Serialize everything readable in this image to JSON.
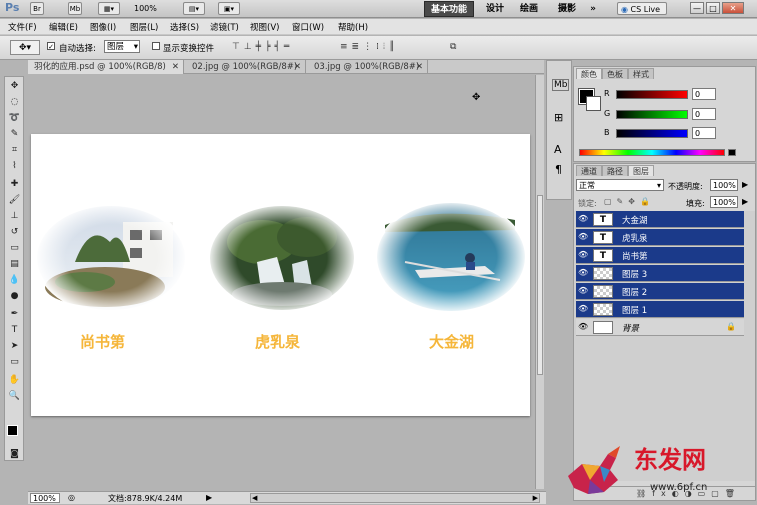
{
  "app": {
    "logo": "Ps"
  },
  "appbar": {
    "btn_br": "Br",
    "btn_mb": "Mb",
    "zoom": "100%",
    "workspaces": [
      "基本功能",
      "设计",
      "绘画",
      "摄影"
    ],
    "more": "»",
    "cslive": "CS Live",
    "win": [
      "—",
      "□",
      "✕"
    ]
  },
  "menubar": {
    "items": [
      "文件(F)",
      "编辑(E)",
      "图像(I)",
      "图层(L)",
      "选择(S)",
      "滤镜(T)",
      "视图(V)",
      "窗口(W)",
      "帮助(H)"
    ]
  },
  "options": {
    "auto_select_label": "自动选择:",
    "auto_select_value": "图层",
    "show_transform_label": "显示变换控件"
  },
  "doc_tabs": [
    {
      "title": "羽化的应用.psd @ 100%(RGB/8)",
      "close": "✕"
    },
    {
      "title": "02.jpg @ 100%(RGB/8#)",
      "close": "✕"
    },
    {
      "title": "03.jpg @ 100%(RGB/8#)",
      "close": "✕"
    }
  ],
  "canvas": {
    "captions": [
      "尚书第",
      "虎乳泉",
      "大金湖"
    ]
  },
  "status": {
    "zoom": "100%",
    "doc": "文档:878.9K/4.24M"
  },
  "color_panel": {
    "tabs": [
      "颜色",
      "色板",
      "样式"
    ],
    "channels": [
      {
        "label": "R",
        "value": "0",
        "color": "#e00000"
      },
      {
        "label": "G",
        "value": "0",
        "color": "#00b000"
      },
      {
        "label": "B",
        "value": "0",
        "color": "#0000e0"
      }
    ]
  },
  "layers_panel": {
    "tabs": [
      "通道",
      "路径",
      "图层"
    ],
    "blend_mode": "正常",
    "opacity_label": "不透明度:",
    "opacity": "100%",
    "lock_label": "锁定:",
    "fill_label": "填充:",
    "fill": "100%",
    "layers": [
      {
        "name": "大金湖",
        "thumb": "T"
      },
      {
        "name": "虎乳泉",
        "thumb": "T"
      },
      {
        "name": "尚书第",
        "thumb": "T"
      },
      {
        "name": "图层 3",
        "thumb": ""
      },
      {
        "name": "图层 2",
        "thumb": ""
      },
      {
        "name": "图层 1",
        "thumb": ""
      },
      {
        "name": "背景",
        "thumb": ""
      }
    ]
  },
  "watermark": {
    "brand": "东发网",
    "url": "www.6pf.cn"
  }
}
